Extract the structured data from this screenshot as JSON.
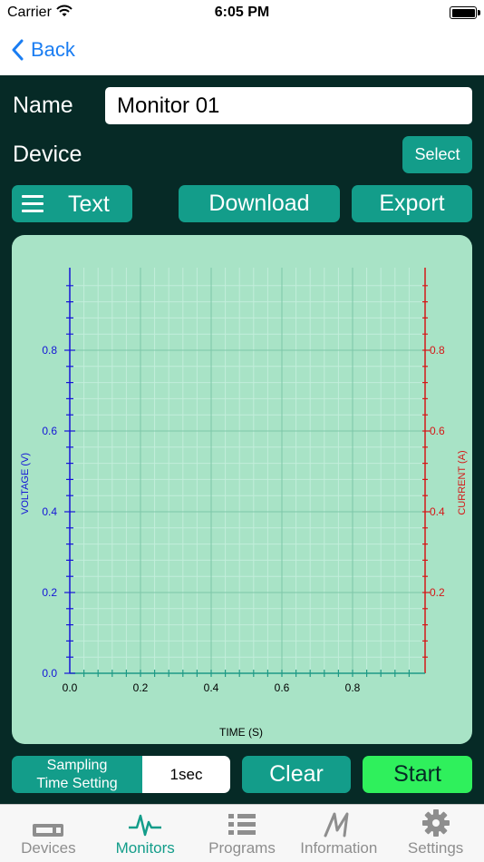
{
  "status_bar": {
    "carrier": "Carrier",
    "time": "6:05 PM"
  },
  "nav": {
    "back_label": "Back"
  },
  "form": {
    "name_label": "Name",
    "name_value": "Monitor 01",
    "device_label": "Device",
    "select_label": "Select"
  },
  "toolbar": {
    "text_label": "Text",
    "download_label": "Download",
    "export_label": "Export"
  },
  "chart_data": {
    "type": "line",
    "xlabel": "TIME (S)",
    "ylabel": "VOLTAGE (V)",
    "y2label": "CURRENT (A)",
    "xlim": [
      0,
      1
    ],
    "ylim": [
      0,
      1
    ],
    "y2lim": [
      0,
      1
    ],
    "x_ticks": [
      "0.0",
      "0.2",
      "0.4",
      "0.6",
      "0.8"
    ],
    "y_ticks": [
      "0.0",
      "0.2",
      "0.4",
      "0.6",
      "0.8"
    ],
    "y2_ticks": [
      "0.2",
      "0.4",
      "0.6",
      "0.8"
    ],
    "grid": true,
    "series": [],
    "colors": {
      "voltage_axis": "#1515d6",
      "current_axis": "#d41818",
      "time_axis": "#1e9a86"
    }
  },
  "controls": {
    "sampling_label_line1": "Sampling",
    "sampling_label_line2": "Time Setting",
    "sampling_value": "1sec",
    "clear_label": "Clear",
    "start_label": "Start"
  },
  "tabs": [
    {
      "label": "Devices",
      "icon": "devices-icon",
      "active": false
    },
    {
      "label": "Monitors",
      "icon": "monitors-icon",
      "active": true
    },
    {
      "label": "Programs",
      "icon": "programs-icon",
      "active": false
    },
    {
      "label": "Information",
      "icon": "information-icon",
      "active": false
    },
    {
      "label": "Settings",
      "icon": "settings-icon",
      "active": false
    }
  ],
  "colors": {
    "accent": "#139d8a",
    "background": "#062a26",
    "start": "#2ff05c",
    "link": "#1a7df2"
  }
}
